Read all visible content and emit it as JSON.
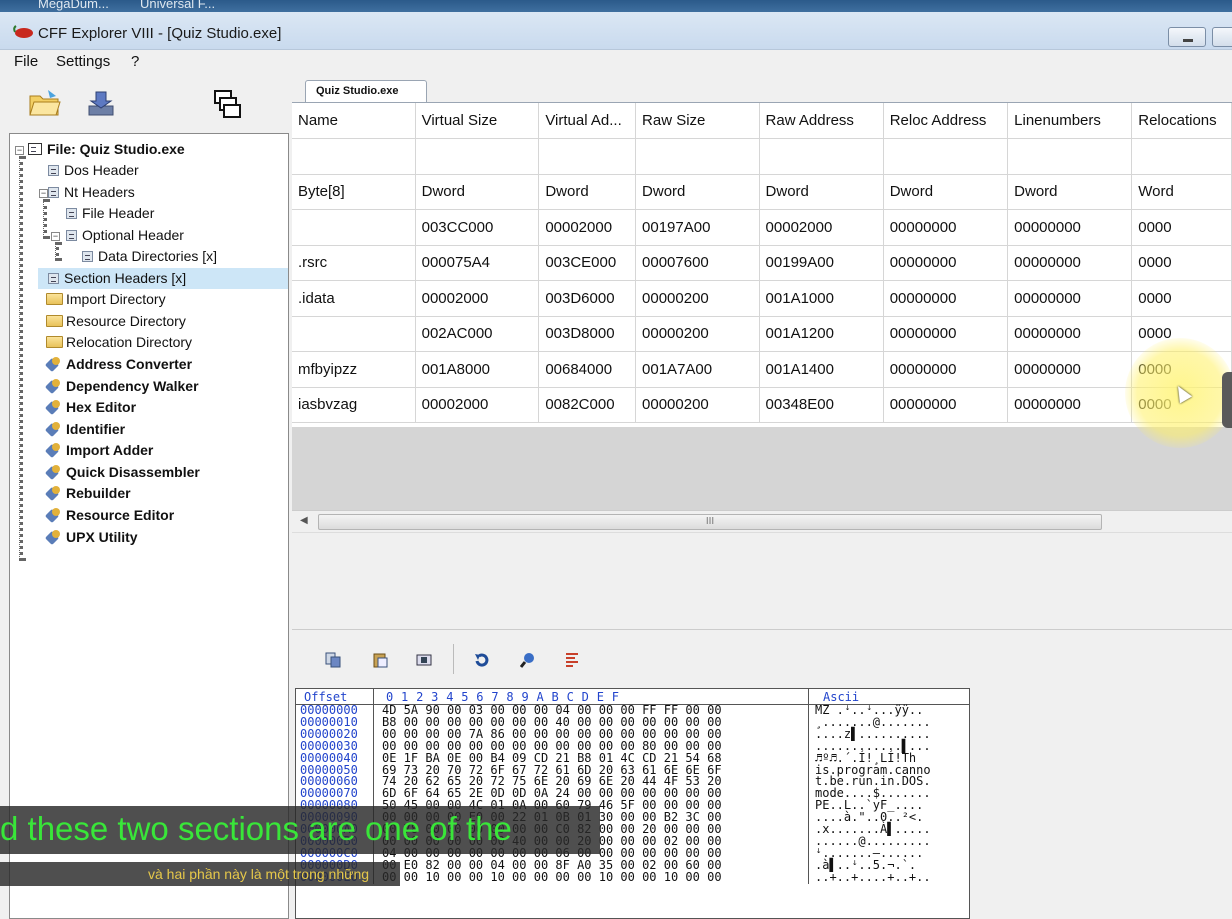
{
  "taskbar": {
    "items": [
      "MegaDum...",
      "Universal F..."
    ]
  },
  "window": {
    "title": "CFF Explorer VIII - [Quiz Studio.exe]"
  },
  "menu": {
    "items": [
      "File",
      "Settings",
      "?"
    ]
  },
  "tree": {
    "root": "File: Quiz Studio.exe",
    "nodes": [
      "Dos Header",
      "Nt Headers",
      "File Header",
      "Optional Header",
      "Data Directories [x]",
      "Section Headers [x]",
      "Import Directory",
      "Resource Directory",
      "Relocation Directory",
      "Address Converter",
      "Dependency Walker",
      "Hex Editor",
      "Identifier",
      "Import Adder",
      "Quick Disassembler",
      "Rebuilder",
      "Resource Editor",
      "UPX Utility"
    ]
  },
  "tab": {
    "label": "Quiz Studio.exe"
  },
  "sections": {
    "columns": [
      "Name",
      "Virtual Size",
      "Virtual Ad...",
      "Raw Size",
      "Raw Address",
      "Reloc Address",
      "Linenumbers",
      "Relocations"
    ],
    "types": [
      "Byte[8]",
      "Dword",
      "Dword",
      "Dword",
      "Dword",
      "Dword",
      "Dword",
      "Word"
    ],
    "rows": [
      [
        "",
        "003CC000",
        "00002000",
        "00197A00",
        "00002000",
        "00000000",
        "00000000",
        "0000"
      ],
      [
        ".rsrc",
        "000075A4",
        "003CE000",
        "00007600",
        "00199A00",
        "00000000",
        "00000000",
        "0000"
      ],
      [
        ".idata",
        "00002000",
        "003D6000",
        "00000200",
        "001A1000",
        "00000000",
        "00000000",
        "0000"
      ],
      [
        "",
        "002AC000",
        "003D8000",
        "00000200",
        "001A1200",
        "00000000",
        "00000000",
        "0000"
      ],
      [
        "mfbyipzz",
        "001A8000",
        "00684000",
        "001A7A00",
        "001A1400",
        "00000000",
        "00000000",
        "0000"
      ],
      [
        "iasbvzag",
        "00002000",
        "0082C000",
        "00000200",
        "00348E00",
        "00000000",
        "00000000",
        "0000"
      ]
    ]
  },
  "scrollbar": {
    "thumb_label": "III"
  },
  "hex": {
    "header_offset": "Offset",
    "header_bytes": "0  1  2  3  4  5  6  7  8  9  A  B  C  D  E  F",
    "header_ascii": "Ascii",
    "offsets": [
      "00000000",
      "00000010",
      "00000020",
      "00000030",
      "00000040",
      "00000050",
      "00000060",
      "00000070",
      "00000080",
      "00000090",
      "000000A0",
      "000000B0",
      "000000C0",
      "000000D0",
      "000000E0"
    ],
    "bytes": [
      "4D 5A 90 00 03 00 00 00 04 00 00 00 FF FF 00 00",
      "B8 00 00 00 00 00 00 00 40 00 00 00 00 00 00 00",
      "00 00 00 00 7A 86 00 00 00 00 00 00 00 00 00 00",
      "00 00 00 00 00 00 00 00 00 00 00 00 80 00 00 00",
      "0E 1F BA 0E 00 B4 09 CD 21 B8 01 4C CD 21 54 68",
      "69 73 20 70 72 6F 67 72 61 6D 20 63 61 6E 6E 6F",
      "74 20 62 65 20 72 75 6E 20 69 6E 20 44 4F 53 20",
      "6D 6F 64 65 2E 0D 0D 0A 24 00 00 00 00 00 00 00",
      "50 45 00 00 4C 01 0A 00 60 79 46 5F 00 00 00 00",
      "00 00 00 00 E0 00 22 01 0B 01 30 00 00 B2 3C 00",
      "00 78 00 00 00 00 00 00 C0 82 00 00 20 00 00 00",
      "00 00 00 00 00 00 40 00 00 20 00 00 00 02 00 00",
      "04 00 00 00 00 00 00 00 06 00 00 00 00 00 00 00",
      "00 E0 82 00 00 04 00 00 8F A0 35 00 02 00 60 00",
      "00 00 10 00 00 10 00 00 00 00 10 00 00 10 00 00"
    ],
    "ascii": [
      "MZ .ꜜ..ꜜ...ÿÿ..",
      "¸.......@.......",
      "....z▌..........",
      "............▌...",
      "♬º♬.´.Í!¸LÍ!Th",
      "is.program.canno",
      "t.be.run.in.DOS.",
      "mode....$.......",
      "PE..L..`yF_....",
      "....à.\"..0..²<.",
      ".x.......À▌.....",
      "......@.........",
      "ꜜ.......—......",
      ".à▌..ꜜ..5.¬.`.",
      "..+..+....+..+.."
    ]
  },
  "subtitles": {
    "english": "d these two sections are one of the",
    "vietnamese": "và hai phần này là một trong những"
  },
  "colors": {
    "selection": "#cde6f7",
    "subtitle_en": "#39e639",
    "subtitle_vi": "#e6c84a",
    "highlight": "#fff578"
  }
}
